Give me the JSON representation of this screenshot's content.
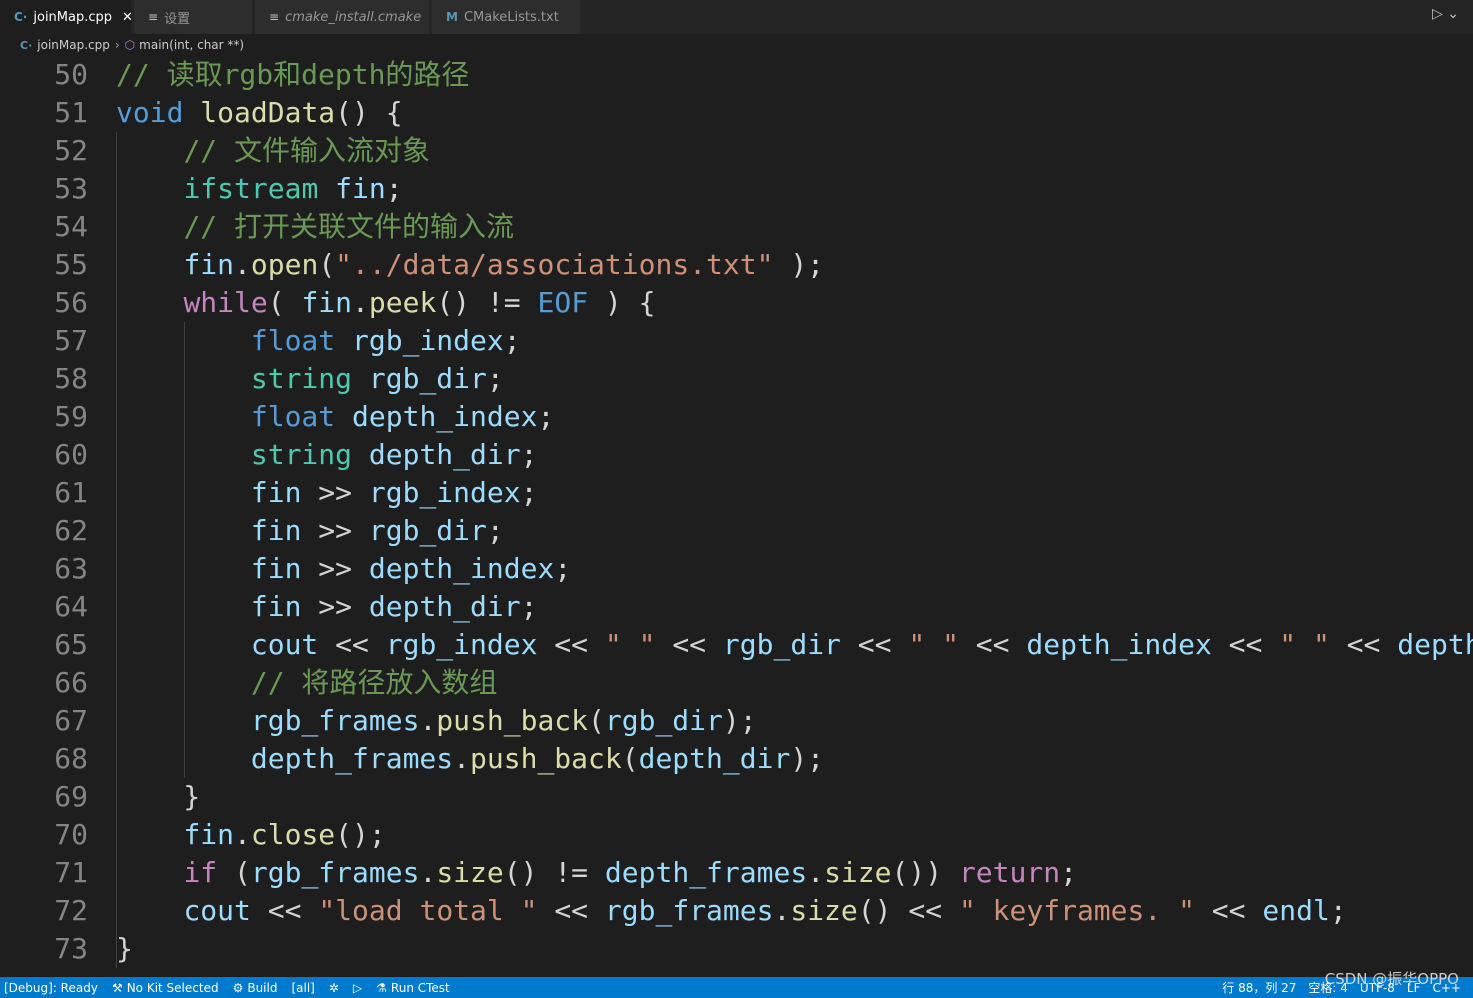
{
  "tabs": [
    {
      "label": "joinMap.cpp",
      "icon": "cpp-file-icon",
      "active": true
    },
    {
      "label": "设置",
      "icon": "settings-doc-icon",
      "active": false
    },
    {
      "label": "cmake_install.cmake",
      "icon": "cmake-doc-icon",
      "active": false
    },
    {
      "label": "CMakeLists.txt",
      "icon": "cmake-m-icon",
      "active": false
    }
  ],
  "breadcrumb": {
    "file": "joinMap.cpp",
    "symbol": "main(int, char **)"
  },
  "line_numbers": [
    "50",
    "51",
    "52",
    "53",
    "54",
    "55",
    "56",
    "57",
    "58",
    "59",
    "60",
    "61",
    "62",
    "63",
    "64",
    "65",
    "66",
    "67",
    "68",
    "69",
    "70",
    "71",
    "72",
    "73"
  ],
  "code_lines": [
    "// 读取rgb和depth的路径",
    "void loadData() {",
    "    // 文件输入流对象",
    "    ifstream fin;",
    "    // 打开关联文件的输入流",
    "    fin.open(\"../data/associations.txt\" );",
    "    while( fin.peek() != EOF ) {",
    "        float rgb_index;",
    "        string rgb_dir;",
    "        float depth_index;",
    "        string depth_dir;",
    "        fin >> rgb_index;",
    "        fin >> rgb_dir;",
    "        fin >> depth_index;",
    "        fin >> depth_dir;",
    "        cout << rgb_index << \" \" << rgb_dir << \" \" << depth_index << \" \" << depth",
    "        // 将路径放入数组",
    "        rgb_frames.push_back(rgb_dir);",
    "        depth_frames.push_back(depth_dir);",
    "    }",
    "    fin.close();",
    "    if (rgb_frames.size() != depth_frames.size()) return;",
    "    cout << \"load total \" << rgb_frames.size() << \" keyframes. \" << endl;",
    "}"
  ],
  "status": {
    "debug": "[Debug]: Ready",
    "kit": "No Kit Selected",
    "build": "Build",
    "target": "[all]",
    "run_ctest": "Run CTest",
    "position": "行 88，列 27",
    "spaces": "空格: 4",
    "encoding": "UTF-8",
    "eol": "LF",
    "language": "C++"
  },
  "watermark": "CSDN @振华OPPO",
  "colors": {
    "editor_bg": "#1e1e1e",
    "status_bg": "#007acc",
    "comment": "#6a9955",
    "keyword": "#569cd6",
    "control": "#c586c0",
    "type": "#4ec9b0",
    "function": "#dcdcaa",
    "variable": "#9cdcfe",
    "string": "#ce9178"
  }
}
